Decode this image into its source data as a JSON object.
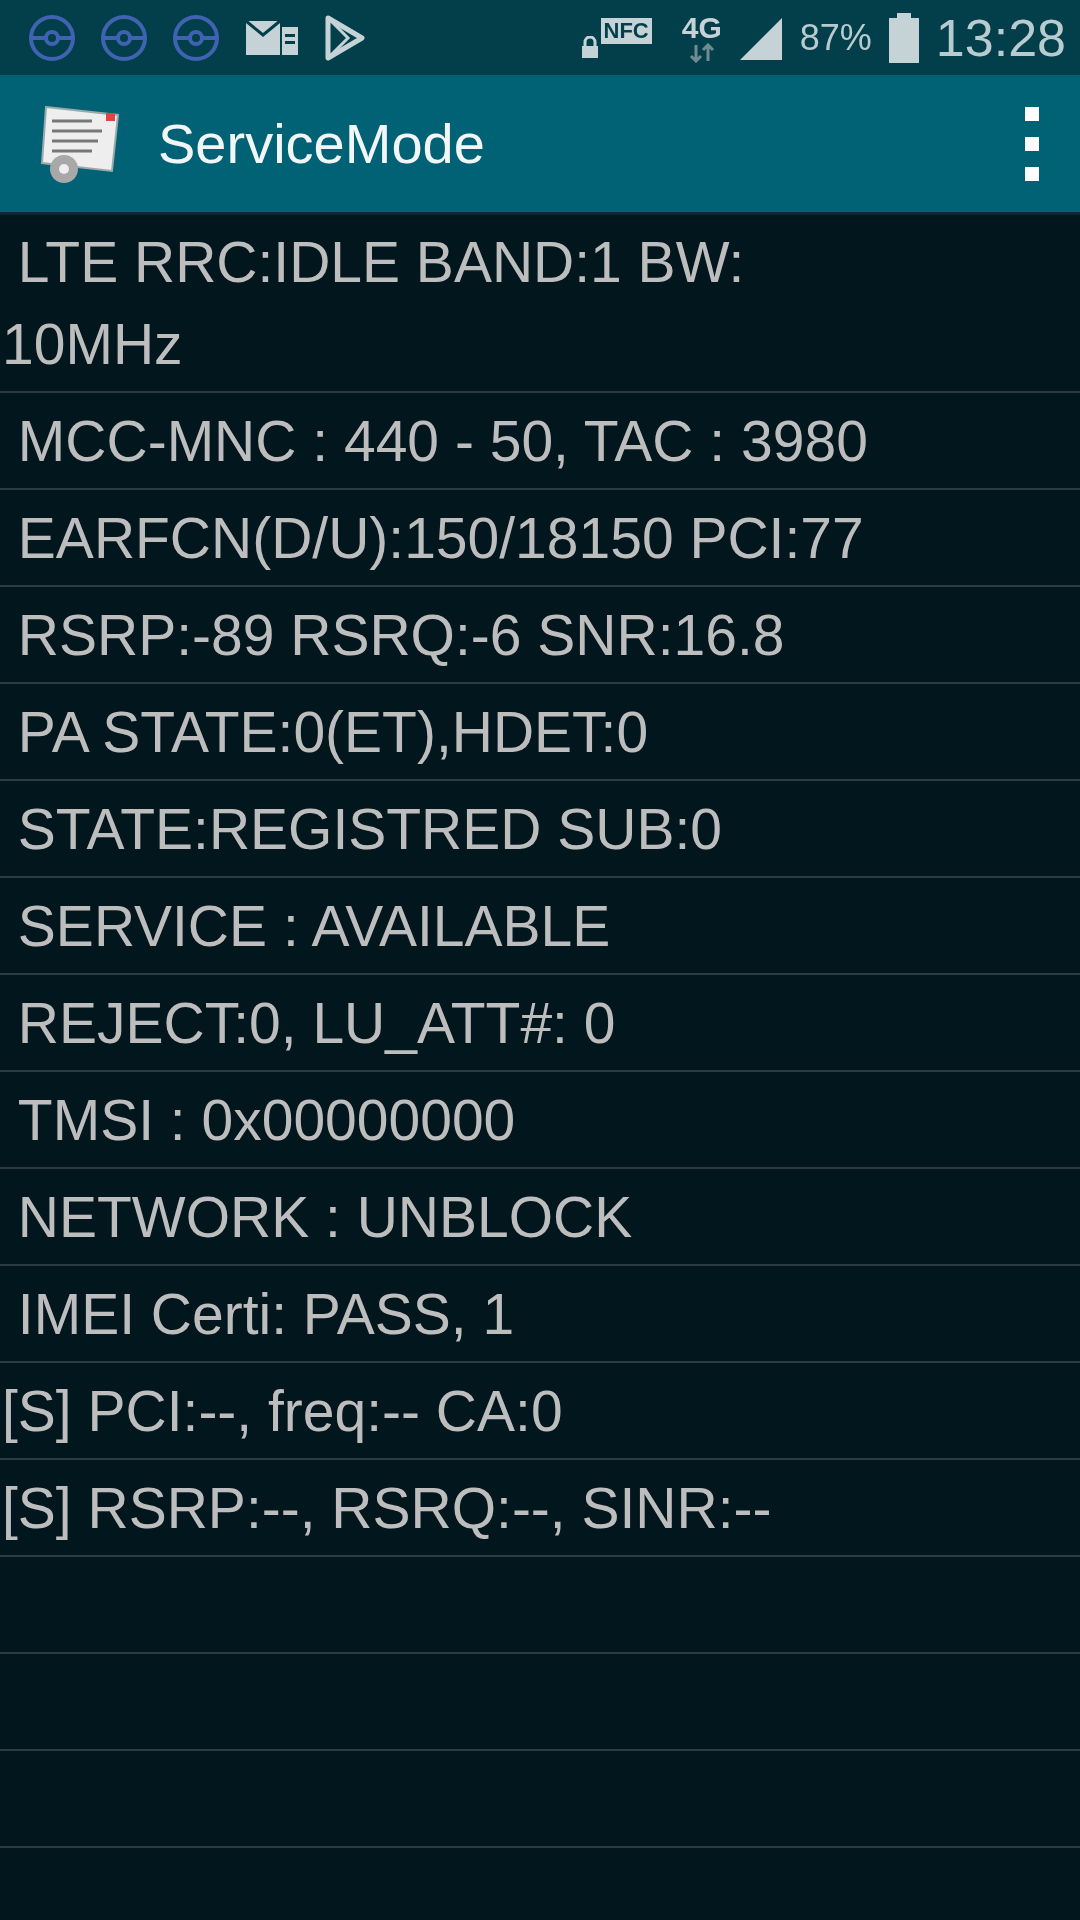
{
  "status_bar": {
    "nfc_label": "NFC",
    "network": "4G",
    "battery": "87%",
    "time": "13:28"
  },
  "app_bar": {
    "title": "ServiceMode"
  },
  "rows": [
    {
      "text": " LTE RRC:IDLE BAND:1 BW:\n10MHz"
    },
    {
      "text": " MCC-MNC : 440 - 50, TAC : 3980"
    },
    {
      "text": " EARFCN(D/U):150/18150 PCI:77"
    },
    {
      "text": " RSRP:-89 RSRQ:-6 SNR:16.8"
    },
    {
      "text": " PA STATE:0(ET),HDET:0"
    },
    {
      "text": " STATE:REGISTRED SUB:0"
    },
    {
      "text": " SERVICE : AVAILABLE"
    },
    {
      "text": " REJECT:0, LU_ATT#: 0"
    },
    {
      "text": " TMSI : 0x00000000"
    },
    {
      "text": " NETWORK : UNBLOCK"
    },
    {
      "text": " IMEI Certi: PASS, 1"
    },
    {
      "text": "[S] PCI:--, freq:-- CA:0"
    },
    {
      "text": "[S] RSRP:--, RSRQ:--, SINR:--"
    }
  ]
}
